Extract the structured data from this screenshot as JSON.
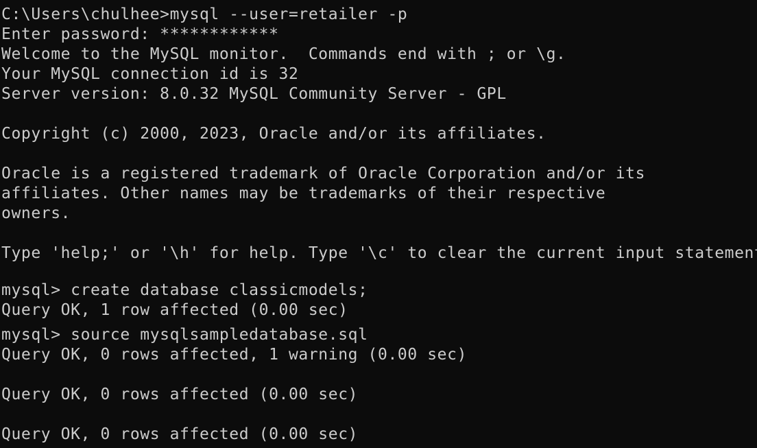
{
  "terminal": {
    "lines": [
      "C:\\Users\\chulhee>mysql --user=retailer -p",
      "Enter password: ************",
      "Welcome to the MySQL monitor.  Commands end with ; or \\g.",
      "Your MySQL connection id is 32",
      "Server version: 8.0.32 MySQL Community Server - GPL",
      "Copyright (c) 2000, 2023, Oracle and/or its affiliates.",
      "Oracle is a registered trademark of Oracle Corporation and/or its",
      "affiliates. Other names may be trademarks of their respective",
      "owners.",
      "Type 'help;' or '\\h' for help. Type '\\c' to clear the current input statement.",
      "mysql> create database classicmodels;",
      "Query OK, 1 row affected (0.00 sec)",
      "mysql> source mysqlsampledatabase.sql",
      "Query OK, 0 rows affected, 1 warning (0.00 sec)",
      "Query OK, 0 rows affected (0.00 sec)",
      "Query OK, 0 rows affected (0.00 sec)"
    ]
  }
}
